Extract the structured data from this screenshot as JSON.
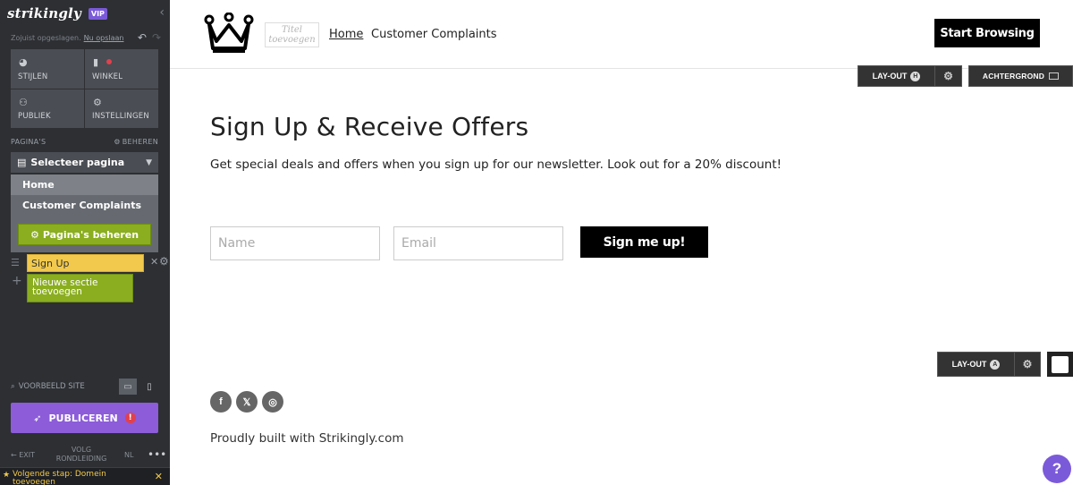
{
  "sidebar": {
    "logo": "strikingly",
    "vip": "VIP",
    "saved_text": "Zojuist opgeslagen.",
    "save_link": "Nu opslaan",
    "tiles": [
      {
        "label": "STIJLEN",
        "icon": "palette-icon"
      },
      {
        "label": "WINKEL",
        "icon": "shopping-bag-icon"
      },
      {
        "label": "PUBLIEK",
        "icon": "people-icon"
      },
      {
        "label": "INSTELLINGEN",
        "icon": "gear-icon"
      }
    ],
    "pages_label": "PAGINA'S",
    "manage_label": "BEHEREN",
    "select_page": "Selecteer pagina",
    "pages": [
      "Home",
      "Customer Complaints"
    ],
    "manage_pages_button": "Pagina's beheren",
    "sections": [
      {
        "label": "Sign Up"
      }
    ],
    "add_section": "Nieuwe sectie toevoegen",
    "preview_label": "VOORBEELD SITE",
    "publish_label": "PUBLICEREN",
    "publish_alert": "!",
    "exit_label": "EXIT",
    "tour_label": "VOLG RONDLEIDING",
    "lang": "NL",
    "next_step": "Volgende stap: Domein toevoegen"
  },
  "site": {
    "title_placeholder": "Titel toevoegen",
    "nav": [
      "Home",
      "Customer Complaints"
    ],
    "start_button": "Start Browsing",
    "layout_label": "LAY-OUT",
    "layout_badge_top": "H",
    "background_label": "ACHTERGROND",
    "heading": "Sign Up & Receive Offers",
    "subtext": "Get special deals and offers when you sign up for our newsletter. Look out for a 20% discount!",
    "name_placeholder": "Name",
    "email_placeholder": "Email",
    "signup_button": "Sign me up!",
    "layout_badge_bottom": "A",
    "socials": [
      "facebook-icon",
      "x-icon",
      "instagram-icon"
    ],
    "footer_text": "Proudly built with Strikingly.com",
    "help": "?"
  },
  "colors": {
    "sidebar_bg": "#2d2f33",
    "accent_purple": "#8c5cd9",
    "green": "#8aae1f",
    "yellow": "#f2c94c"
  }
}
